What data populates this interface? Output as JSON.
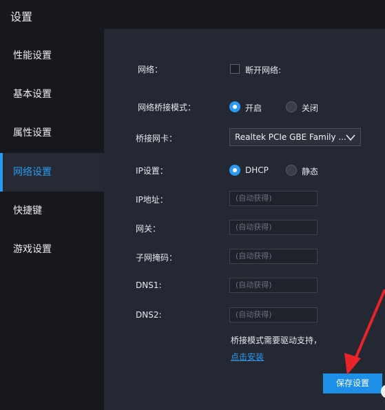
{
  "window": {
    "title": "设置"
  },
  "sidebar": {
    "items": [
      {
        "label": "性能设置"
      },
      {
        "label": "基本设置"
      },
      {
        "label": "属性设置"
      },
      {
        "label": "网络设置",
        "active": true
      },
      {
        "label": "快捷键"
      },
      {
        "label": "游戏设置"
      }
    ]
  },
  "network": {
    "network_label": "网络：",
    "disconnect_label": "断开网络:",
    "disconnect_checked": false,
    "bridge_mode_label": "网络桥接模式：",
    "bridge_on_label": "开启",
    "bridge_off_label": "关闭",
    "bridge_selected": "开启",
    "bridge_nic_label": "桥接网卡：",
    "bridge_nic_value": "Realtek PCIe GBE Family ...",
    "ip_setting_label": "IP设置：",
    "dhcp_label": "DHCP",
    "static_label": "静态",
    "ip_mode_selected": "DHCP",
    "ip_address_label": "IP地址：",
    "gateway_label": "网关：",
    "subnet_label": "子网掩码：",
    "dns1_label": "DNS1:",
    "dns2_label": "DNS2:",
    "field_placeholder": "(自动获得)",
    "hint_text": "桥接模式需要驱动支持，",
    "install_link": "点击安装",
    "save_button": "保存设置"
  },
  "colors": {
    "accent": "#2a9bf0",
    "annotation_arrow": "#e8242a",
    "sidebar_bg": "#16181e",
    "content_bg": "#242833"
  }
}
